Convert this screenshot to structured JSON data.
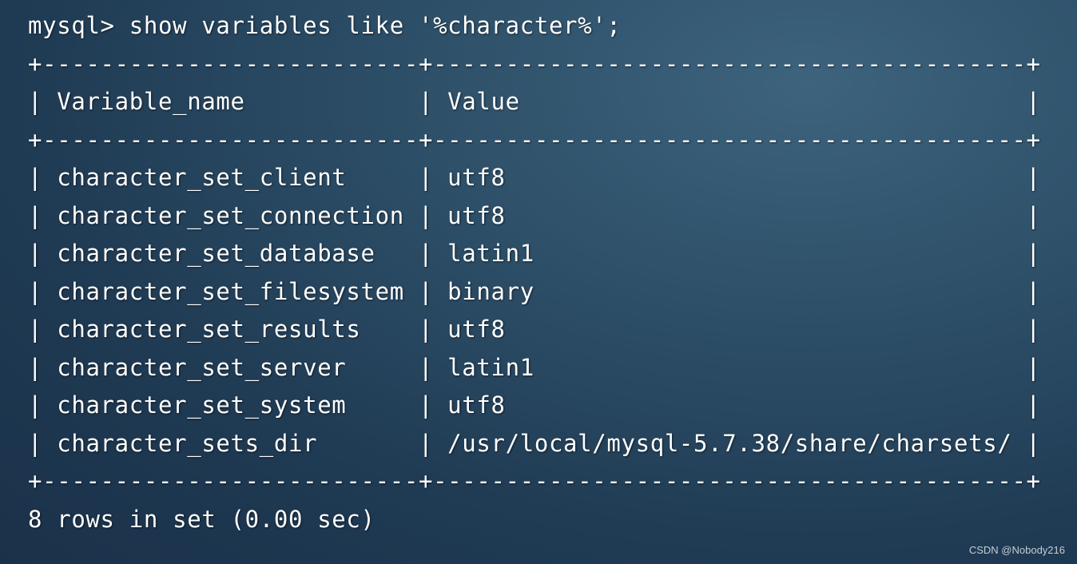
{
  "terminal": {
    "lines": [
      "mysql> show variables like '%character%';",
      "+--------------------------+-----------------------------------------+",
      "| Variable_name            | Value                                   |",
      "+--------------------------+-----------------------------------------+",
      "| character_set_client     | utf8                                    |",
      "| character_set_connection | utf8                                    |",
      "| character_set_database   | latin1                                  |",
      "| character_set_filesystem | binary                                  |",
      "| character_set_results    | utf8                                    |",
      "| character_set_server     | latin1                                  |",
      "| character_set_system     | utf8                                    |",
      "| character_sets_dir       | /usr/local/mysql-5.7.38/share/charsets/ |",
      "+--------------------------+-----------------------------------------+",
      "8 rows in set (0.00 sec)"
    ]
  },
  "watermark": "CSDN @Nobody216"
}
